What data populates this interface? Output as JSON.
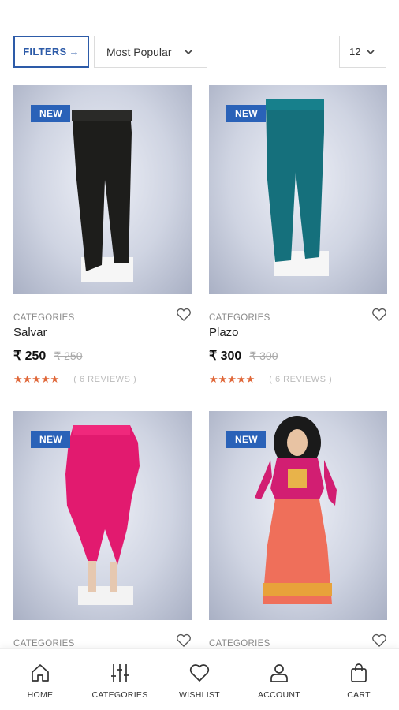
{
  "toolbar": {
    "filters_label": "FILTERS",
    "filters_arrow": "→",
    "sort_value": "Most Popular",
    "count_value": "12"
  },
  "products": [
    {
      "badge": "NEW",
      "category": "CATEGORIES",
      "name": "Salvar",
      "price": "₹ 250",
      "old_price": "₹ 250",
      "rating": 5,
      "stars": "★★★★★",
      "reviews": "( 6 REVIEWS )",
      "color": "#1d1d1b"
    },
    {
      "badge": "NEW",
      "category": "CATEGORIES",
      "name": "Plazo",
      "price": "₹ 300",
      "old_price": "₹ 300",
      "rating": 5,
      "stars": "★★★★★",
      "reviews": "( 6 REVIEWS )",
      "color": "#15707c"
    },
    {
      "badge": "NEW",
      "category": "CATEGORIES",
      "color": "#e21a6f"
    },
    {
      "badge": "NEW",
      "category": "CATEGORIES",
      "color": "#ef6f5a"
    }
  ],
  "nav": [
    {
      "label": "HOME",
      "icon": "home-icon"
    },
    {
      "label": "CATEGORIES",
      "icon": "sliders-icon"
    },
    {
      "label": "WISHLIST",
      "icon": "heart-icon"
    },
    {
      "label": "ACCOUNT",
      "icon": "user-icon"
    },
    {
      "label": "CART",
      "icon": "bag-icon"
    }
  ],
  "colors": {
    "accent": "#2a62b8",
    "star": "#e0683a"
  }
}
